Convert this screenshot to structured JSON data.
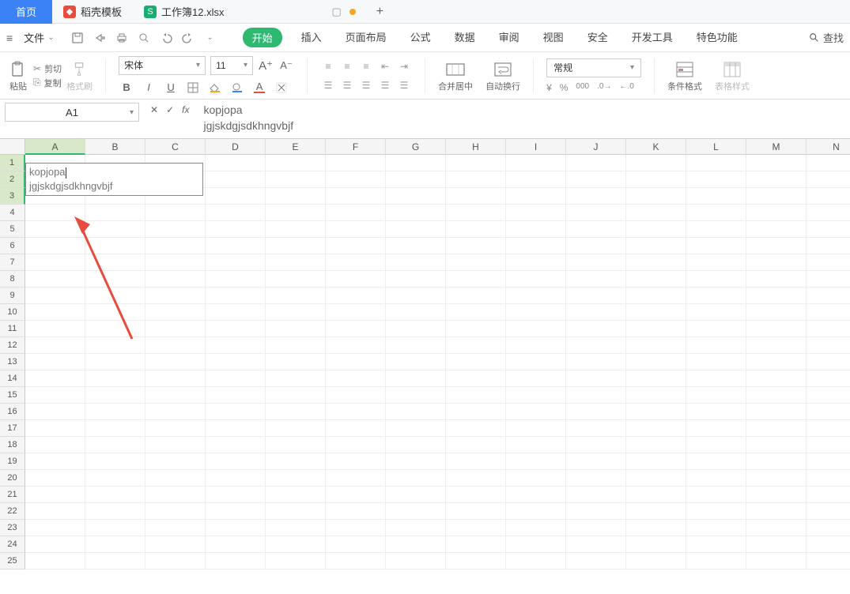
{
  "tabs": {
    "home": "首页",
    "template": "稻壳模板",
    "workbook": "工作簿12.xlsx"
  },
  "menu": {
    "file": "文件",
    "tabs": [
      "开始",
      "插入",
      "页面布局",
      "公式",
      "数据",
      "审阅",
      "视图",
      "安全",
      "开发工具",
      "特色功能"
    ],
    "search": "查找"
  },
  "ribbon": {
    "paste": "粘贴",
    "cut": "剪切",
    "copy": "复制",
    "format_painter": "格式刷",
    "font_name": "宋体",
    "font_size": "11",
    "merge_center": "合并居中",
    "wrap_text": "自动换行",
    "number_format": "常规",
    "cond_format": "条件格式",
    "table_style": "表格样式"
  },
  "namebox": "A1",
  "formula": {
    "line1": "kopjopa",
    "line2": "jgjskdgjsdkhngvbjf"
  },
  "columns": [
    "A",
    "B",
    "C",
    "D",
    "E",
    "F",
    "G",
    "H",
    "I",
    "J",
    "K",
    "L",
    "M",
    "N"
  ],
  "rows": [
    "1",
    "2",
    "3",
    "4",
    "5",
    "6",
    "7",
    "8",
    "9",
    "10",
    "11",
    "12",
    "13",
    "14",
    "15",
    "16",
    "17",
    "18",
    "19",
    "20",
    "21",
    "22",
    "23",
    "24",
    "25"
  ],
  "cell_edit": {
    "line1": "kopjopa",
    "line2": "jgjskdgjsdkhngvbjf"
  }
}
